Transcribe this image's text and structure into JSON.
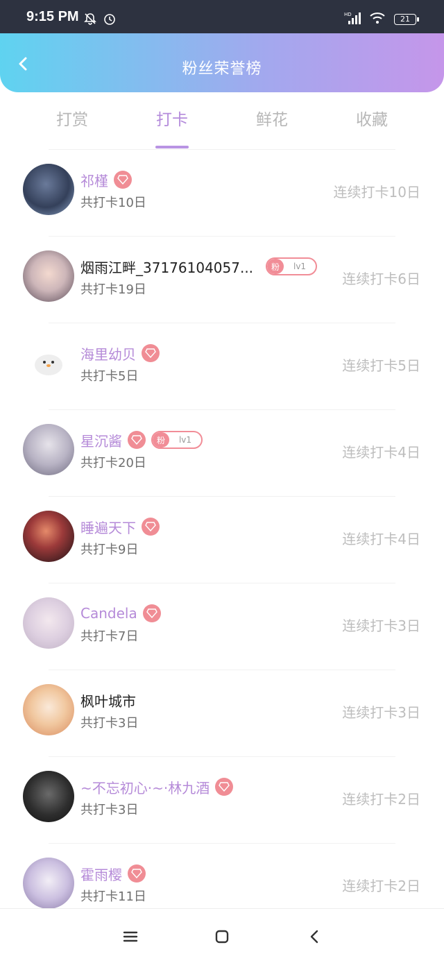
{
  "status": {
    "time": "9:15 PM",
    "battery": "21"
  },
  "header": {
    "title": "粉丝荣誉榜"
  },
  "tabs": [
    {
      "label": "打赏",
      "active": false
    },
    {
      "label": "打卡",
      "active": true
    },
    {
      "label": "鲜花",
      "active": false
    },
    {
      "label": "收藏",
      "active": false
    }
  ],
  "fans": [
    {
      "name": "祁槿",
      "purple": true,
      "diamond": true,
      "badge": null,
      "total": "共打卡10日",
      "streak": "连续打卡10日"
    },
    {
      "name": "烟雨江畔_37176104057...",
      "purple": false,
      "diamond": false,
      "badge": {
        "left": "粉",
        "right": "lv1"
      },
      "total": "共打卡19日",
      "streak": "连续打卡6日"
    },
    {
      "name": "海里幼贝",
      "purple": true,
      "diamond": true,
      "badge": null,
      "total": "共打卡5日",
      "streak": "连续打卡5日"
    },
    {
      "name": "星沉酱",
      "purple": true,
      "diamond": true,
      "badge": {
        "left": "粉",
        "right": "lv1"
      },
      "total": "共打卡20日",
      "streak": "连续打卡4日"
    },
    {
      "name": "睡遍天下",
      "purple": true,
      "diamond": true,
      "badge": null,
      "total": "共打卡9日",
      "streak": "连续打卡4日"
    },
    {
      "name": "Candela",
      "purple": true,
      "diamond": true,
      "badge": null,
      "total": "共打卡7日",
      "streak": "连续打卡3日"
    },
    {
      "name": "枫叶城市",
      "purple": false,
      "diamond": false,
      "badge": null,
      "total": "共打卡3日",
      "streak": "连续打卡3日"
    },
    {
      "name": "~不忘初心·~·林九酒",
      "purple": true,
      "diamond": true,
      "badge": null,
      "total": "共打卡3日",
      "streak": "连续打卡2日"
    },
    {
      "name": "霍雨樱",
      "purple": true,
      "diamond": true,
      "badge": null,
      "total": "共打卡11日",
      "streak": "连续打卡2日"
    }
  ],
  "colors": {
    "accent": "#b48bdb",
    "diamond": "#f08d95",
    "header_start": "#5fd3f0",
    "header_end": "#c596ea"
  }
}
